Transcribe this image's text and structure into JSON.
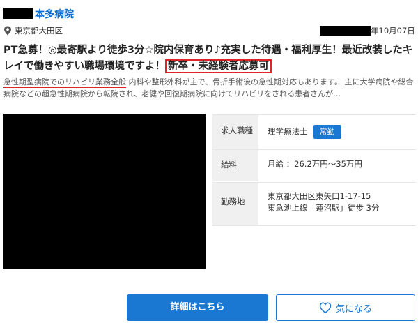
{
  "header": {
    "hospital_name": "本多病院",
    "location": "東京都大田区",
    "date": "年10月07日"
  },
  "listing": {
    "title_main": "PT急募！◎最寄駅より徒歩3分☆院内保育あり♪充実した待遇・福利厚生！最近改装したキレイで働きやすい職場環境ですよ！",
    "title_highlight": "新卒・未経験者応募可",
    "desc_underlined": "急性期型病院でのリハビリ業務全般",
    "desc_rest": " 内科や整形外科が主で、骨折手術後の急性期対応もあります。 主に大学病院や総合病院などの超急性期病院から転院され、老健や回復期病院に向けてリハビリをされる患者さんが…"
  },
  "info": {
    "job_label": "求人職種",
    "job_value": "理学療法士",
    "job_badge": "常勤",
    "salary_label": "給料",
    "salary_value": "月給 ：26.2万円〜35万円",
    "location_label": "勤務地",
    "address_line1": "東京都大田区東矢口1-17-15",
    "address_line2": "東急池上線「蓮沼駅」徒歩 3分"
  },
  "buttons": {
    "detail_label": "詳細はこちら",
    "favorite_label": "気になる"
  },
  "icons": {
    "location": "map-pin-icon",
    "favorite": "heart-icon"
  },
  "colors": {
    "accent": "#1a77d2",
    "highlight_red": "#e0242a"
  }
}
